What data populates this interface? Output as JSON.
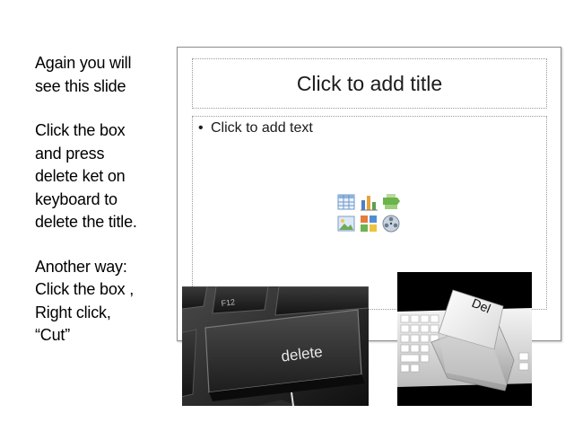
{
  "instructions": {
    "paragraph1": "Again you will\nsee this slide",
    "paragraph2": "Click the box\nand press\ndelete ket on\nkeyboard to\ndelete the title.",
    "paragraph3": "Another way:\nClick the box ,\nRight click,\n“Cut”"
  },
  "slide": {
    "title_placeholder": "Click to add title",
    "bullet_glyph": "•",
    "body_placeholder": "Click to add text",
    "insert_icons": [
      "table-icon",
      "chart-icon",
      "smartart-icon",
      "picture-icon",
      "clipart-icon",
      "media-icon"
    ]
  },
  "photo_delete_key": {
    "key_label": "delete",
    "upper_key_label": "F12"
  },
  "photo_del_key": {
    "key_label": "Del"
  }
}
